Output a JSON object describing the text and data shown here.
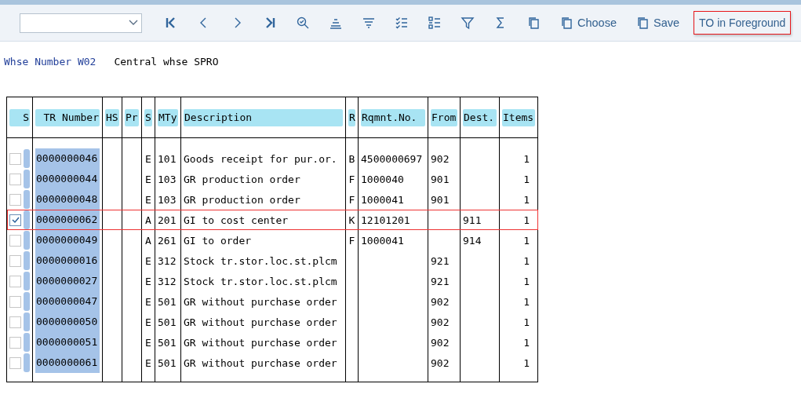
{
  "toolbar": {
    "tools": [
      {
        "kind": "first"
      },
      {
        "kind": "previous"
      },
      {
        "kind": "next"
      },
      {
        "kind": "last"
      },
      {
        "kind": "find"
      },
      {
        "kind": "sort-up"
      },
      {
        "kind": "sort-down"
      },
      {
        "kind": "checklist"
      },
      {
        "kind": "list"
      },
      {
        "kind": "filter"
      },
      {
        "kind": "sum"
      },
      {
        "kind": "copy"
      },
      {
        "kind": "copy",
        "label": "Choose"
      },
      {
        "kind": "copy",
        "label": "Save"
      },
      {
        "kind": "text",
        "label": "TO in Foreground",
        "highlighted": true
      }
    ]
  },
  "header": {
    "label": "Whse Number W02",
    "value": "Central whse SPRO"
  },
  "table": {
    "columns": [
      "S",
      "TR Number",
      "HS",
      "Pr",
      "S",
      "MTy",
      "Description",
      "R",
      "Rqmnt.No.",
      "From",
      "Dest.",
      "Items"
    ],
    "rows": [
      {
        "checked": false,
        "selected": false,
        "cells": [
          "",
          "0000000046",
          "",
          "",
          "E",
          "101",
          "Goods receipt for pur.or.",
          "B",
          "4500000697",
          "902",
          "",
          "1"
        ]
      },
      {
        "checked": false,
        "selected": false,
        "cells": [
          "",
          "0000000044",
          "",
          "",
          "E",
          "103",
          "GR production order",
          "F",
          "1000040",
          "901",
          "",
          "1"
        ]
      },
      {
        "checked": false,
        "selected": false,
        "cells": [
          "",
          "0000000048",
          "",
          "",
          "E",
          "103",
          "GR production order",
          "F",
          "1000041",
          "901",
          "",
          "1"
        ]
      },
      {
        "checked": true,
        "selected": true,
        "cells": [
          "",
          "0000000062",
          "",
          "",
          "A",
          "201",
          "GI to cost center",
          "K",
          "12101201",
          "",
          "911",
          "1"
        ]
      },
      {
        "checked": false,
        "selected": false,
        "cells": [
          "",
          "0000000049",
          "",
          "",
          "A",
          "261",
          "GI to order",
          "F",
          "1000041",
          "",
          "914",
          "1"
        ]
      },
      {
        "checked": false,
        "selected": false,
        "cells": [
          "",
          "0000000016",
          "",
          "",
          "E",
          "312",
          "Stock tr.stor.loc.st.plcm",
          "",
          "",
          "921",
          "",
          "1"
        ]
      },
      {
        "checked": false,
        "selected": false,
        "cells": [
          "",
          "0000000027",
          "",
          "",
          "E",
          "312",
          "Stock tr.stor.loc.st.plcm",
          "",
          "",
          "921",
          "",
          "1"
        ]
      },
      {
        "checked": false,
        "selected": false,
        "cells": [
          "",
          "0000000047",
          "",
          "",
          "E",
          "501",
          "GR without purchase order",
          "",
          "",
          "902",
          "",
          "1"
        ]
      },
      {
        "checked": false,
        "selected": false,
        "cells": [
          "",
          "0000000050",
          "",
          "",
          "E",
          "501",
          "GR without purchase order",
          "",
          "",
          "902",
          "",
          "1"
        ]
      },
      {
        "checked": false,
        "selected": false,
        "cells": [
          "",
          "0000000051",
          "",
          "",
          "E",
          "501",
          "GR without purchase order",
          "",
          "",
          "902",
          "",
          "1"
        ]
      },
      {
        "checked": false,
        "selected": false,
        "cells": [
          "",
          "0000000061",
          "",
          "",
          "E",
          "501",
          "GR without purchase order",
          "",
          "",
          "902",
          "",
          "1"
        ]
      }
    ]
  }
}
